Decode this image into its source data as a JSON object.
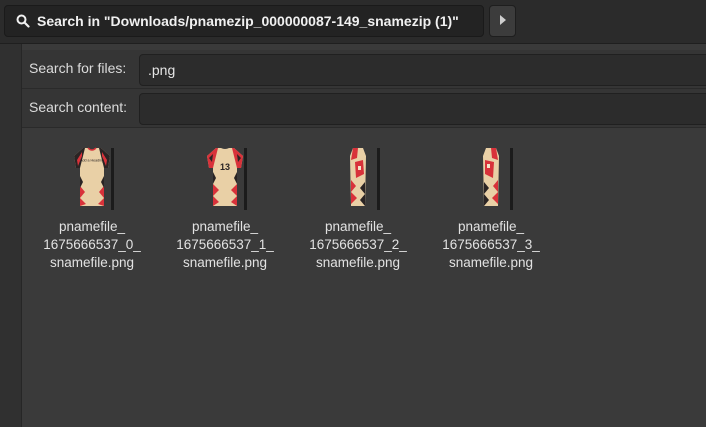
{
  "header": {
    "search_title": "Search in \"Downloads/pnamezip_000000087-149_snamezip (1)\""
  },
  "search": {
    "files_label": "Search for files:",
    "files_value": ".png",
    "content_label": "Search content:",
    "content_value": ""
  },
  "files": [
    {
      "line1": "pnamefile_",
      "line2": "1675666537_0_",
      "line3": "snamefile.png",
      "thumb_text": "Add a Heading"
    },
    {
      "line1": "pnamefile_",
      "line2": "1675666537_1_",
      "line3": "snamefile.png",
      "thumb_text": "13"
    },
    {
      "line1": "pnamefile_",
      "line2": "1675666537_2_",
      "line3": "snamefile.png",
      "thumb_text": ""
    },
    {
      "line1": "pnamefile_",
      "line2": "1675666537_3_",
      "line3": "snamefile.png",
      "thumb_text": ""
    }
  ],
  "colors": {
    "jersey_base": "#e9d0a6",
    "jersey_red": "#d8323a",
    "jersey_dark": "#2a2424"
  }
}
